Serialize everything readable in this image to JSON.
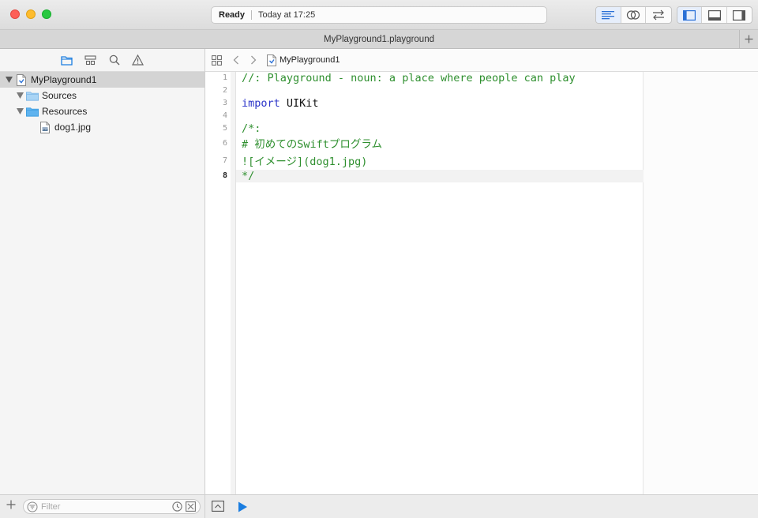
{
  "window": {
    "status_state": "Ready",
    "status_time": "Today at 17:25"
  },
  "tab": {
    "title": "MyPlayground1.playground"
  },
  "navigator": {
    "items": [
      {
        "label": "MyPlayground1",
        "icon": "playground-file-icon"
      },
      {
        "label": "Sources",
        "icon": "folder-icon"
      },
      {
        "label": "Resources",
        "icon": "folder-icon"
      },
      {
        "label": "dog1.jpg",
        "icon": "image-file-icon"
      }
    ],
    "filter_placeholder": "Filter"
  },
  "jumpbar": {
    "crumb": "MyPlayground1"
  },
  "editor": {
    "line_numbers": [
      "1",
      "2",
      "3",
      "4",
      "5",
      "6",
      "7",
      "8"
    ],
    "active_line": "8",
    "lines": [
      "//: Playground - noun: a place where people can play",
      "",
      "UIKit",
      "",
      "/*:",
      "# 初めてのSwiftプログラム",
      "![イメージ](dog1.jpg)",
      "*/"
    ],
    "keyword_import": "import"
  },
  "colors": {
    "comment": "#2e8f2e",
    "keyword": "#2b34c9",
    "accent": "#1a7de0"
  }
}
